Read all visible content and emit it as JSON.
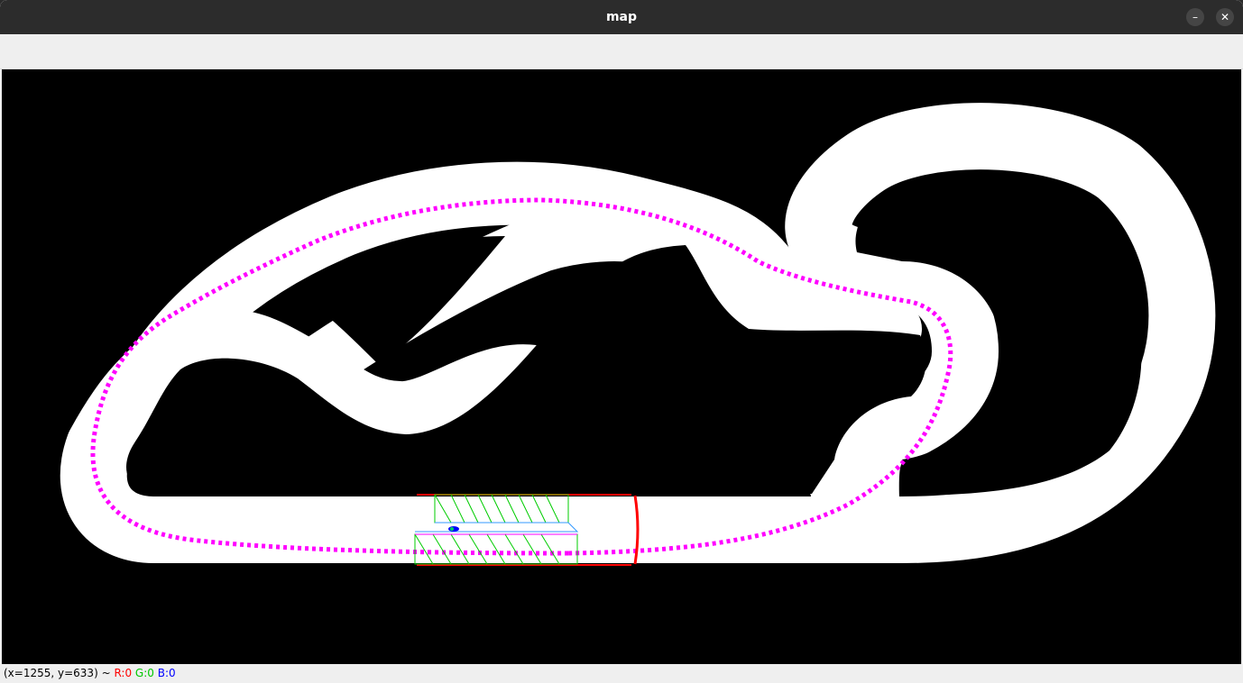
{
  "window": {
    "title": "map",
    "minimize_icon": "minimize-icon",
    "close_icon": "close-icon",
    "minimize_glyph": "–",
    "close_glyph": "✕"
  },
  "map": {
    "track_color": "#ffffff",
    "background_color": "#000000",
    "path_color": "#ff00ff",
    "boundary_color": "#ff0000",
    "mesh_color": "#00cc00",
    "vehicle_color": "#0000ff"
  },
  "status": {
    "coords": "(x=1255, y=633) ~ ",
    "r": "R:0",
    "g": "G:0",
    "b": "B:0"
  }
}
